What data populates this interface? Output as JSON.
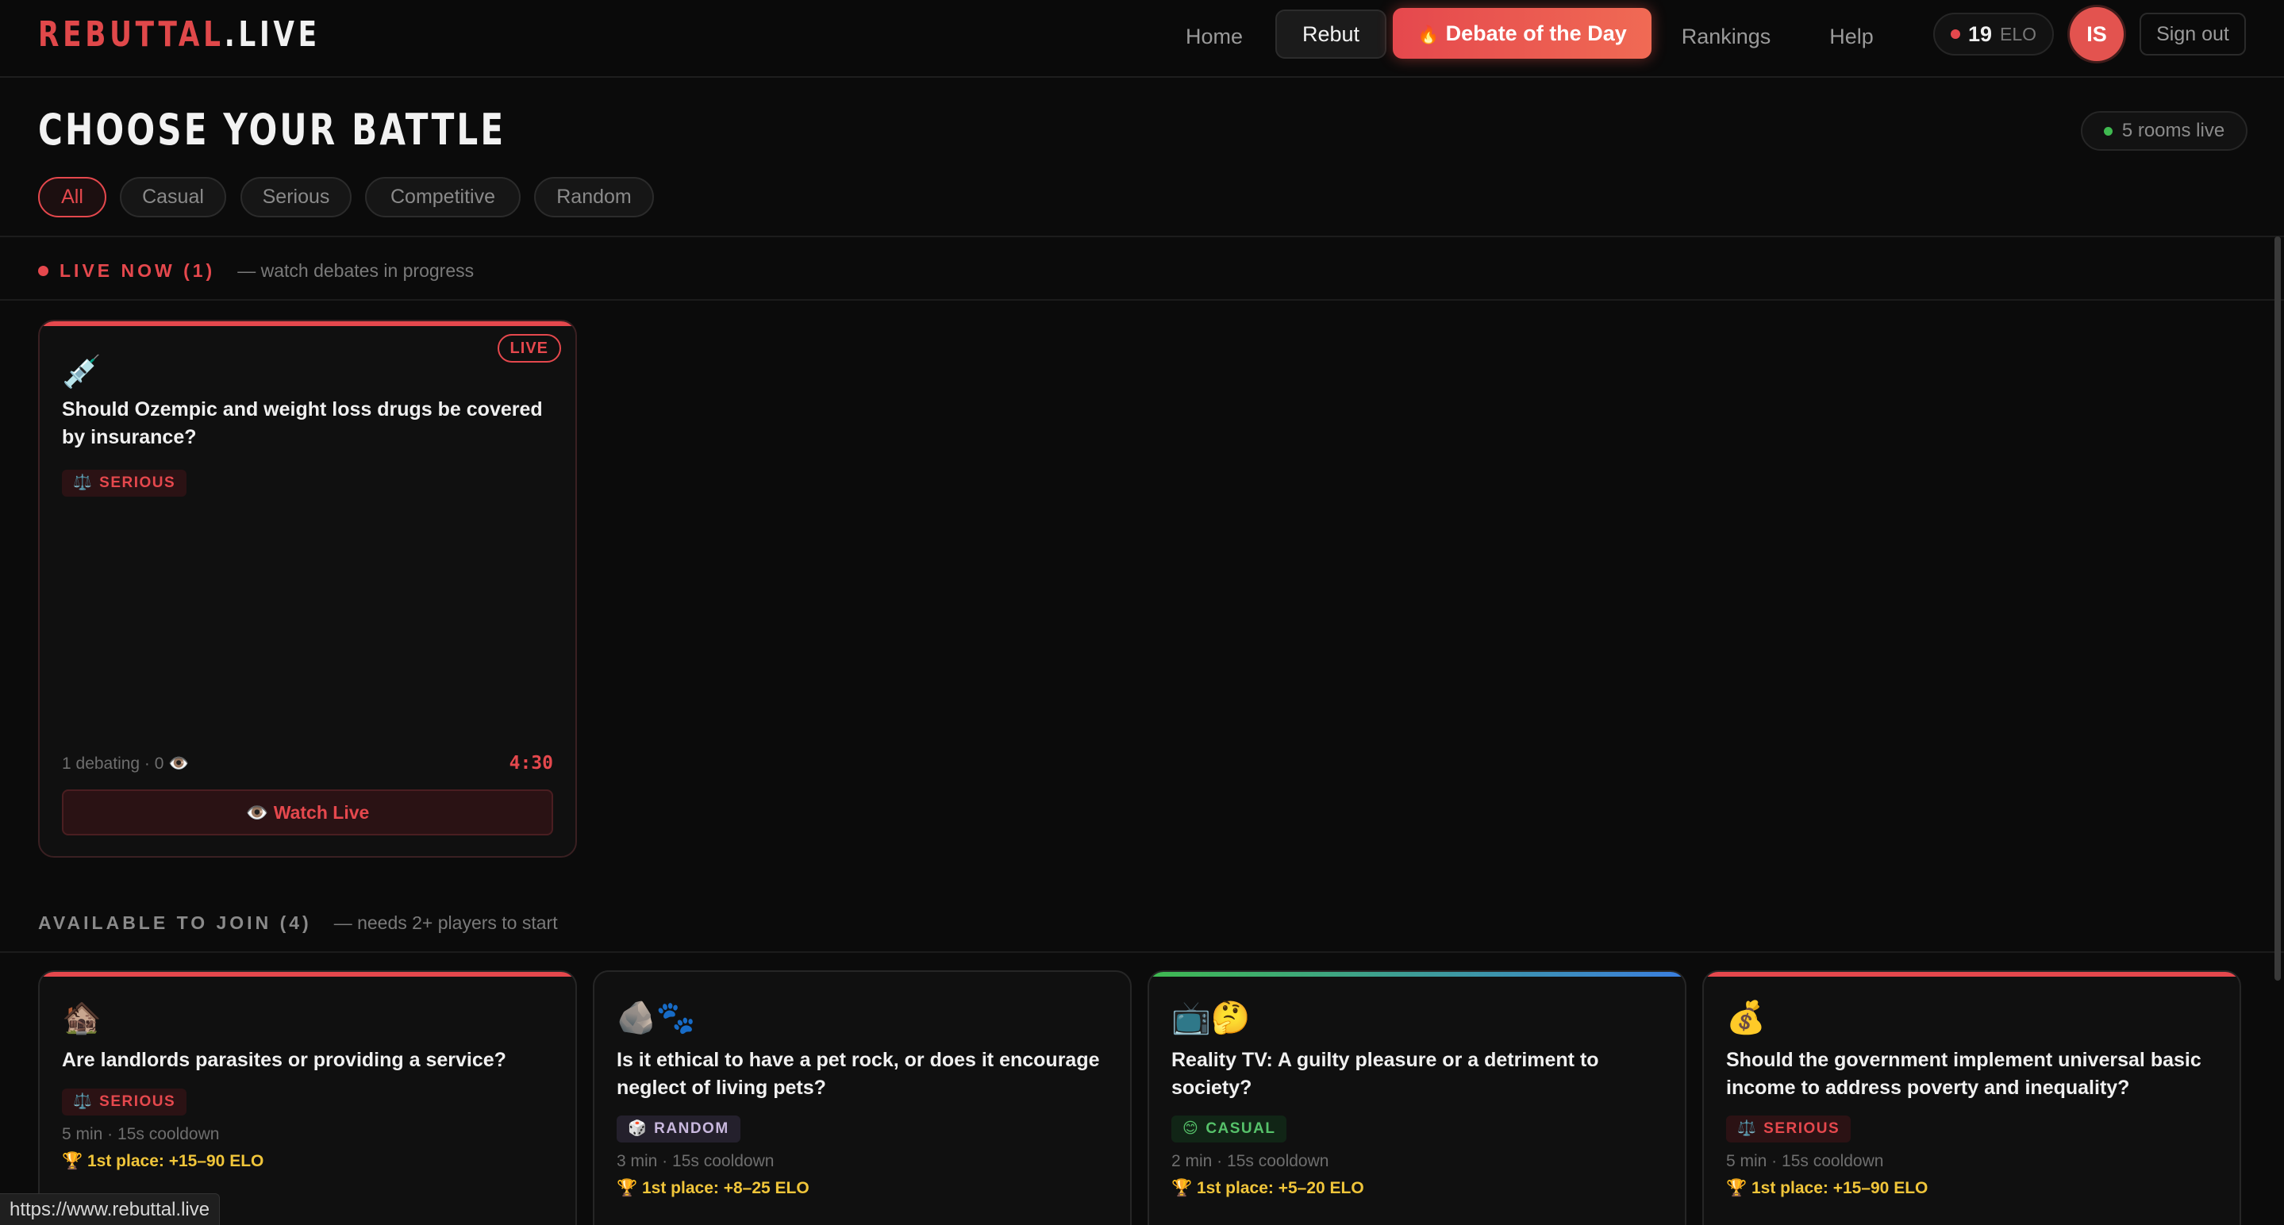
{
  "logo": {
    "part1": "REBUTTAL",
    "part2": ".LIVE"
  },
  "nav": {
    "home": "Home",
    "rebut": "Rebut",
    "debate_of_day": "Debate of the Day",
    "rankings": "Rankings",
    "help": "Help",
    "elo_value": "19",
    "elo_label": "ELO",
    "avatar_initials": "IS",
    "sign_out": "Sign out"
  },
  "page": {
    "title": "CHOOSE YOUR BATTLE",
    "rooms_live": "5 rooms live",
    "filters": [
      "All",
      "Casual",
      "Serious",
      "Competitive",
      "Random"
    ],
    "active_filter": "All"
  },
  "live_section": {
    "label": "LIVE NOW (1)",
    "sub": "— watch debates in progress",
    "cards": [
      {
        "emoji": "💉",
        "question": "Should Ozempic and weight loss drugs be covered by insurance?",
        "badge": "SERIOUS",
        "badge_icon": "⚖️",
        "live_label": "LIVE",
        "stats": "1 debating · 0 👁️",
        "timer": "4:30",
        "watch_label": "👁️ Watch Live"
      }
    ]
  },
  "available_section": {
    "label": "AVAILABLE TO JOIN (4)",
    "sub": "— needs 2+ players to start",
    "cards": [
      {
        "emoji": "🏚️",
        "question": "Are landlords parasites or providing a service?",
        "badge": "SERIOUS",
        "badge_icon": "⚖️",
        "badge_type": "serious",
        "meta": "5 min · 15s cooldown",
        "prize": "🏆 1st place: +15–90 ELO",
        "accent": "#e5484d"
      },
      {
        "emoji": "🪨🐾",
        "question": "Is it ethical to have a pet rock, or does it encourage neglect of living pets?",
        "badge": "RANDOM",
        "badge_icon": "🎲",
        "badge_type": "random",
        "meta": "3 min · 15s cooldown",
        "prize": "🏆 1st place: +8–25 ELO",
        "accent": "none"
      },
      {
        "emoji": "📺🤔",
        "question": "Reality TV: A guilty pleasure or a detriment to society?",
        "badge": "CASUAL",
        "badge_icon": "😊",
        "badge_type": "casual",
        "meta": "2 min · 15s cooldown",
        "prize": "🏆 1st place: +5–20 ELO",
        "accent": "green-blue"
      },
      {
        "emoji": "💰",
        "question": "Should the government implement universal basic income to address poverty and inequality?",
        "badge": "SERIOUS",
        "badge_icon": "⚖️",
        "badge_type": "serious",
        "meta": "5 min · 15s cooldown",
        "prize": "🏆 1st place: +15–90 ELO",
        "accent": "#e5484d"
      }
    ]
  },
  "status_bar_url": "https://www.rebuttal.live",
  "colors": {
    "accent": "#e5484d",
    "background": "#0b0b0b",
    "gold": "#f0c53a",
    "casual": "#56c26a"
  }
}
